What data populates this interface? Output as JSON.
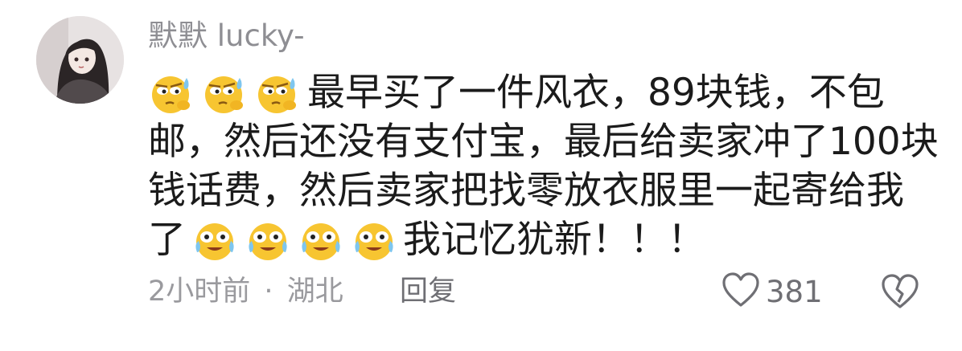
{
  "comment": {
    "username": "默默 lucky-",
    "lines": [
      {
        "emojis": [
          "sweat-smirk-emoji",
          "sweat-smirk-emoji",
          "sweat-smirk-emoji"
        ],
        "text": "最早买了一件风衣，89块钱，不包"
      },
      {
        "emojis": [],
        "text": "邮，然后还没有支付宝，最后给卖家冲了100块"
      },
      {
        "emojis": [],
        "text": "钱话费，然后卖家把找零放衣服里一起寄给我"
      },
      {
        "emojis": [],
        "text": "了"
      },
      {
        "emojis": [],
        "text": "我记忆犹新！！！"
      }
    ],
    "time": "2小时前",
    "separator": "·",
    "location": "湖北",
    "reply_label": "回复",
    "like_count": "381"
  },
  "icons": {
    "like": "heart-outline-icon",
    "dislike": "broken-heart-icon"
  },
  "colors": {
    "text": "#1b1b1b",
    "secondary": "#9a9a9e",
    "emoji_yellow": "#f7c531"
  }
}
